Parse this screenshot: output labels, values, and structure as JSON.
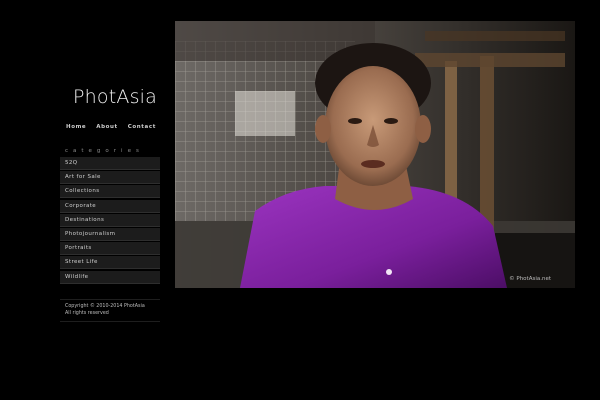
{
  "site": {
    "logo_text": "PhotAsia"
  },
  "nav": {
    "items": [
      {
        "label": "Home"
      },
      {
        "label": "About"
      },
      {
        "label": "Contact"
      }
    ]
  },
  "categories": {
    "heading": "categories",
    "items": [
      {
        "label": "52Q"
      },
      {
        "label": "Art for Sale"
      },
      {
        "label": "Collections"
      },
      {
        "label": "Corporate"
      },
      {
        "label": "Destinations"
      },
      {
        "label": "Photojournalism"
      },
      {
        "label": "Portraits"
      },
      {
        "label": "Street Life"
      },
      {
        "label": "Wildlife"
      }
    ]
  },
  "footer": {
    "copyright_line1": "Copyright © 2010-2014 PhotAsia",
    "copyright_line2": "All rights reserved"
  },
  "photo": {
    "watermark": "© PhotAsia.net"
  },
  "colors": {
    "background": "#000000",
    "menu_item_bg": "#1c1c1c",
    "text": "#cfcfcf",
    "accent_purple": "#8a2aa8"
  }
}
